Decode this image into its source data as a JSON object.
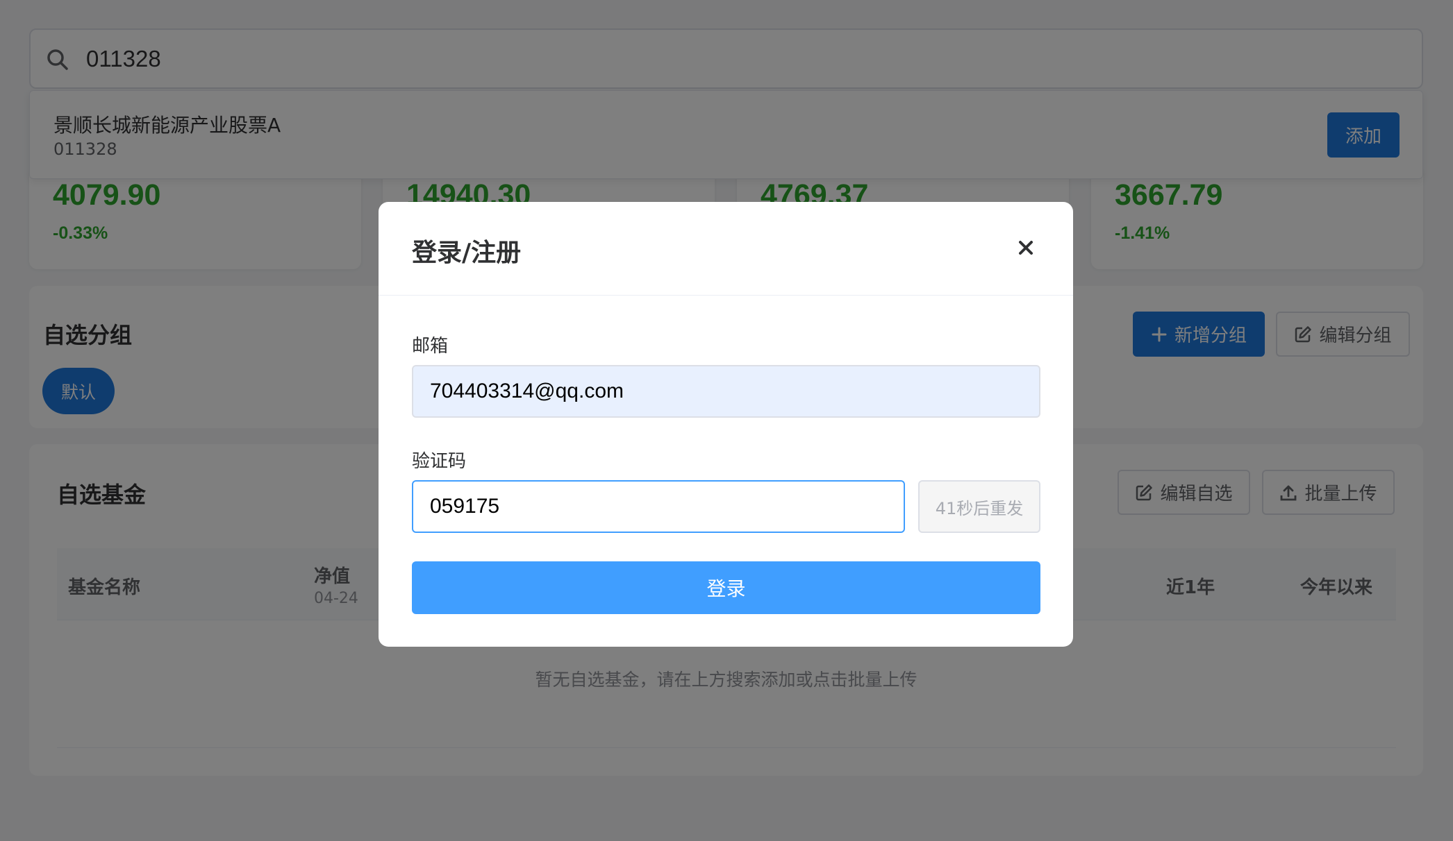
{
  "search": {
    "value": "011328"
  },
  "suggestion": {
    "name": "景顺长城新能源产业股票A",
    "code": "011328",
    "add_label": "添加"
  },
  "indices": [
    {
      "value": "4079.90",
      "change": "-0.33%"
    },
    {
      "value": "14940.30",
      "change": ""
    },
    {
      "value": "4769.37",
      "change": ""
    },
    {
      "value": "3667.79",
      "change": "-1.41%"
    }
  ],
  "groups": {
    "title": "自选分组",
    "chips": [
      "默认"
    ],
    "add_label": "新增分组",
    "edit_label": "编辑分组"
  },
  "funds": {
    "title": "自选基金",
    "edit_label": "编辑自选",
    "upload_label": "批量上传",
    "columns": {
      "name": "基金名称",
      "nav": "净值",
      "nav_date": "04-24",
      "year1": "近1年",
      "ytd": "今年以来"
    },
    "empty_text": "暂无自选基金，请在上方搜索添加或点击批量上传"
  },
  "modal": {
    "title": "登录/注册",
    "email_label": "邮箱",
    "email_value": "704403314@qq.com",
    "code_label": "验证码",
    "code_value": "059175",
    "resend_label": "41秒后重发",
    "submit_label": "登录"
  },
  "colors": {
    "primary": "#1e78dc",
    "submit": "#409eff",
    "down": "#2fa52f"
  }
}
